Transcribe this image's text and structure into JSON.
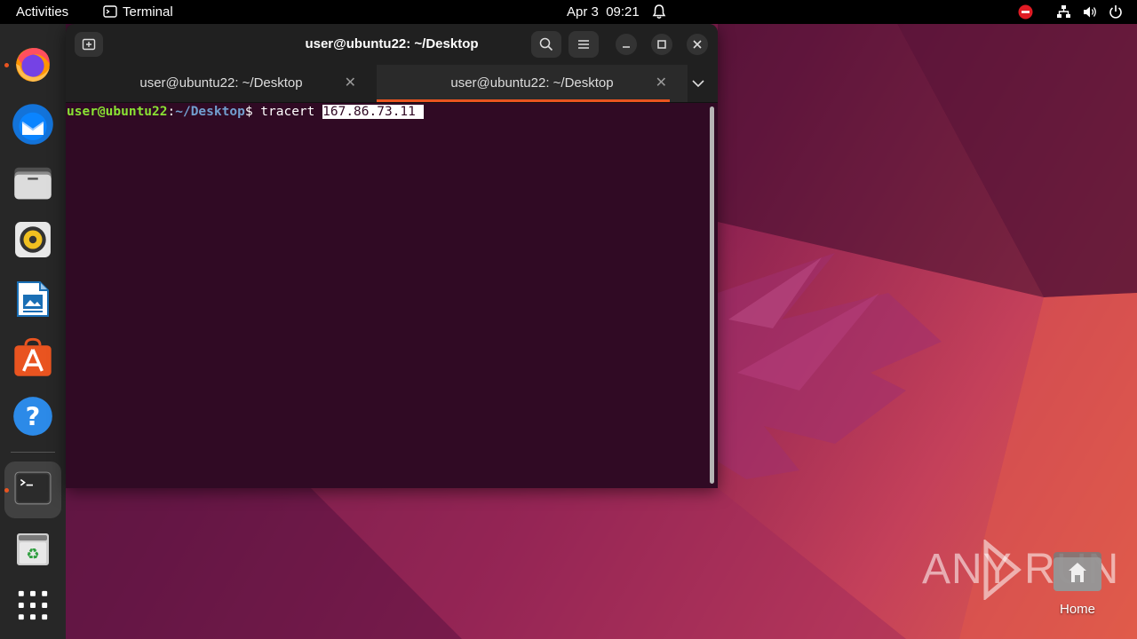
{
  "topbar": {
    "activities": "Activities",
    "app_name": "Terminal",
    "date": "Apr 3",
    "time": "09:21"
  },
  "dock": {
    "items": [
      {
        "name": "firefox",
        "running": true
      },
      {
        "name": "thunderbird",
        "running": false
      },
      {
        "name": "files",
        "running": false
      },
      {
        "name": "rhythmbox",
        "running": false
      },
      {
        "name": "libreoffice-writer",
        "running": false
      },
      {
        "name": "app-center",
        "running": false
      },
      {
        "name": "help",
        "running": false
      },
      {
        "name": "terminal",
        "running": true
      },
      {
        "name": "trash",
        "running": false
      },
      {
        "name": "show-apps",
        "running": false
      }
    ]
  },
  "terminal": {
    "title": "user@ubuntu22: ~/Desktop",
    "tabs": [
      {
        "label": "user@ubuntu22: ~/Desktop",
        "active": false
      },
      {
        "label": "user@ubuntu22: ~/Desktop",
        "active": true
      }
    ],
    "prompt_user": "user@ubuntu22",
    "prompt_sep": ":",
    "prompt_path": "~/Desktop",
    "prompt_symbol": "$ ",
    "command": "tracert ",
    "selected_text": "167.86.73.11 "
  },
  "desktop": {
    "home_label": "Home",
    "watermark": "ANY RUN"
  },
  "colors": {
    "accent": "#e95420",
    "terminal_bg": "#300a24",
    "prompt_user": "#8ae234",
    "prompt_path": "#729fcf"
  }
}
